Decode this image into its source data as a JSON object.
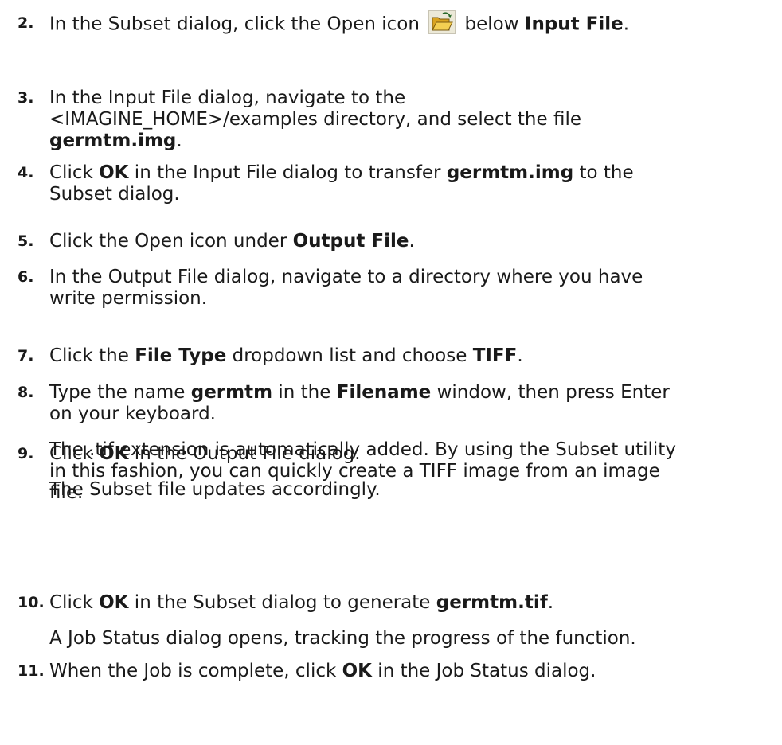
{
  "steps": [
    {
      "num": "2.",
      "lines": [
        [
          {
            "t": "In the Subset dialog, click the Open icon "
          },
          {
            "icon": "open-folder-icon"
          },
          {
            "t": " below "
          },
          {
            "t": "Input File",
            "b": true
          },
          {
            "t": "."
          }
        ]
      ],
      "notes": []
    },
    {
      "num": "3.",
      "lines": [
        [
          {
            "t": "In the Input File dialog, navigate to the"
          }
        ],
        [
          {
            "t": "<IMAGINE_HOME>/examples directory, and select the file"
          }
        ],
        [
          {
            "t": "germtm.img",
            "b": true
          },
          {
            "t": "."
          }
        ]
      ],
      "notes": []
    },
    {
      "num": "4.",
      "lines": [
        [
          {
            "t": "Click "
          },
          {
            "t": "OK",
            "b": true
          },
          {
            "t": " in the Input File dialog to transfer "
          },
          {
            "t": "germtm.img",
            "b": true
          },
          {
            "t": " to the"
          }
        ],
        [
          {
            "t": "Subset dialog."
          }
        ]
      ],
      "notes": []
    },
    {
      "num": "5.",
      "lines": [
        [
          {
            "t": "Click the Open icon under "
          },
          {
            "t": "Output File",
            "b": true
          },
          {
            "t": "."
          }
        ]
      ],
      "notes": []
    },
    {
      "num": "6.",
      "lines": [
        [
          {
            "t": "In the Output File dialog, navigate to a directory where you have"
          }
        ],
        [
          {
            "t": "write permission."
          }
        ]
      ],
      "notes": []
    },
    {
      "num": "7.",
      "lines": [
        [
          {
            "t": "Click the "
          },
          {
            "t": "File Type",
            "b": true
          },
          {
            "t": " dropdown list and choose "
          },
          {
            "t": "TIFF",
            "b": true
          },
          {
            "t": "."
          }
        ]
      ],
      "notes": []
    },
    {
      "num": "8.",
      "lines": [
        [
          {
            "t": "Type the name "
          },
          {
            "t": "germtm",
            "b": true
          },
          {
            "t": " in the "
          },
          {
            "t": "Filename",
            "b": true
          },
          {
            "t": " window, then press Enter"
          }
        ],
        [
          {
            "t": "on your keyboard."
          }
        ]
      ],
      "notes": [
        [
          [
            {
              "t": "The .tif extension is automatically added. By using the Subset utility"
            }
          ],
          [
            {
              "t": "in this fashion, you can quickly create a TIFF image from an image"
            }
          ],
          [
            {
              "t": "file."
            }
          ]
        ]
      ]
    },
    {
      "num": "9.",
      "lines": [
        [
          {
            "t": "Click "
          },
          {
            "t": "OK",
            "b": true
          },
          {
            "t": " in the Output File dialog."
          }
        ]
      ],
      "notes": [
        [
          [
            {
              "t": "The Subset file updates accordingly."
            }
          ]
        ]
      ]
    },
    {
      "num": "10.",
      "lines": [
        [
          {
            "t": "Click "
          },
          {
            "t": "OK",
            "b": true
          },
          {
            "t": " in the Subset dialog to generate "
          },
          {
            "t": "germtm.tif",
            "b": true
          },
          {
            "t": "."
          }
        ]
      ],
      "notes": [
        [
          [
            {
              "t": "A Job Status dialog opens, tracking the progress of the function."
            }
          ]
        ]
      ]
    },
    {
      "num": "11.",
      "lines": [
        [
          {
            "t": "When the Job is complete, click "
          },
          {
            "t": "OK",
            "b": true
          },
          {
            "t": " in the Job Status dialog."
          }
        ]
      ],
      "notes": []
    }
  ]
}
